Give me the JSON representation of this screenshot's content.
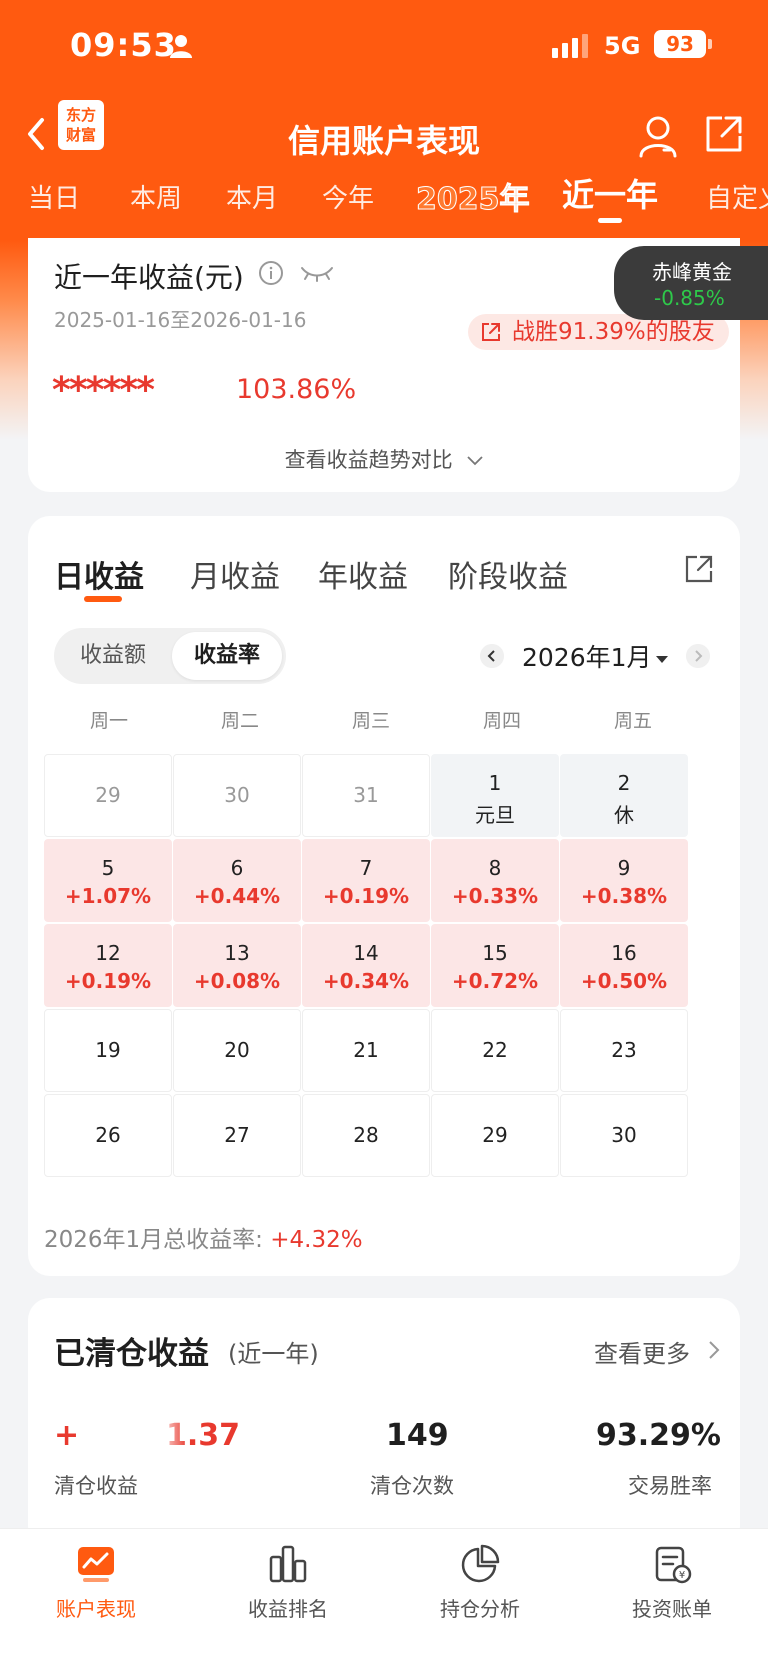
{
  "status_bar": {
    "time": "09:53",
    "network": "5G",
    "battery": "93"
  },
  "nav": {
    "logo_line1": "东方",
    "logo_line2": "财富",
    "title": "信用账户表现"
  },
  "period_tabs": [
    "当日",
    "本周",
    "本月",
    "今年",
    "2025年",
    "近一年",
    "自定义"
  ],
  "summary": {
    "title": "近一年收益(元)",
    "date_range": "2025-01-16至2026-01-16",
    "beat_text": "战胜91.39%的股友",
    "masked_value": "******",
    "rate": "103.86%",
    "trend_link": "查看收益趋势对比"
  },
  "stock_float": {
    "name": "赤峰黄金",
    "change": "-0.85%"
  },
  "calendar": {
    "earn_tabs": [
      "日收益",
      "月收益",
      "年收益",
      "阶段收益"
    ],
    "toggle": [
      "收益额",
      "收益率"
    ],
    "month": "2026年1月",
    "weekdays": [
      "周一",
      "周二",
      "周三",
      "周四",
      "周五"
    ],
    "rows": [
      [
        {
          "day": "29",
          "sub": "",
          "kind": "faded"
        },
        {
          "day": "30",
          "sub": "",
          "kind": "faded"
        },
        {
          "day": "31",
          "sub": "",
          "kind": "faded"
        },
        {
          "day": "1",
          "sub": "元旦",
          "kind": "holiday"
        },
        {
          "day": "2",
          "sub": "休",
          "kind": "holiday"
        }
      ],
      [
        {
          "day": "5",
          "sub": "+1.07%",
          "kind": "gain"
        },
        {
          "day": "6",
          "sub": "+0.44%",
          "kind": "gain"
        },
        {
          "day": "7",
          "sub": "+0.19%",
          "kind": "gain"
        },
        {
          "day": "8",
          "sub": "+0.33%",
          "kind": "gain"
        },
        {
          "day": "9",
          "sub": "+0.38%",
          "kind": "gain"
        }
      ],
      [
        {
          "day": "12",
          "sub": "+0.19%",
          "kind": "gain"
        },
        {
          "day": "13",
          "sub": "+0.08%",
          "kind": "gain"
        },
        {
          "day": "14",
          "sub": "+0.34%",
          "kind": "gain"
        },
        {
          "day": "15",
          "sub": "+0.72%",
          "kind": "gain"
        },
        {
          "day": "16",
          "sub": "+0.50%",
          "kind": "gain"
        }
      ],
      [
        {
          "day": "19",
          "sub": "",
          "kind": "plain"
        },
        {
          "day": "20",
          "sub": "",
          "kind": "plain"
        },
        {
          "day": "21",
          "sub": "",
          "kind": "plain"
        },
        {
          "day": "22",
          "sub": "",
          "kind": "plain"
        },
        {
          "day": "23",
          "sub": "",
          "kind": "plain"
        }
      ],
      [
        {
          "day": "26",
          "sub": "",
          "kind": "plain"
        },
        {
          "day": "27",
          "sub": "",
          "kind": "plain"
        },
        {
          "day": "28",
          "sub": "",
          "kind": "plain"
        },
        {
          "day": "29",
          "sub": "",
          "kind": "plain"
        },
        {
          "day": "30",
          "sub": "",
          "kind": "plain"
        }
      ]
    ],
    "month_total_label": "2026年1月总收益率:",
    "month_total_value": "+4.32%"
  },
  "cleared": {
    "title": "已清仓收益",
    "subtitle": "(近一年)",
    "more": "查看更多",
    "stats": [
      {
        "value_prefix": "+",
        "value": "1.37",
        "label": "清仓收益"
      },
      {
        "value": "149",
        "label": "清仓次数"
      },
      {
        "value": "93.29%",
        "label": "交易胜率"
      }
    ]
  },
  "bottom_nav": [
    "账户表现",
    "收益排名",
    "持仓分析",
    "投资账单"
  ],
  "colors": {
    "brand": "#ff5a10",
    "gain_red": "#e8392e",
    "loss_green": "#2ec94a"
  }
}
